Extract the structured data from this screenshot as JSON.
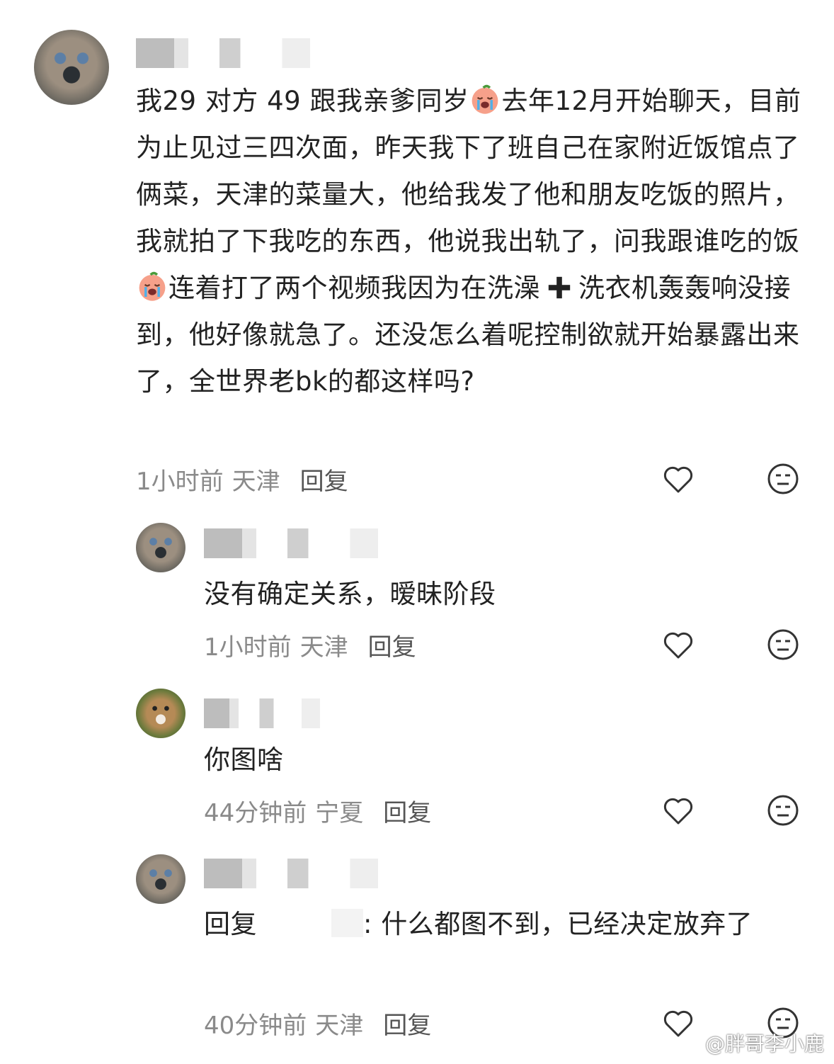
{
  "comments": [
    {
      "text_line1_a": "我29 对方 49 跟我亲爹同岁",
      "text_line1_b": "去年12月开始聊",
      "text_mid": "天，目前为止见过三四次面，昨天我下了班自己在家附近饭馆点了俩菜，天津的菜量大，他给我发了他和朋友吃饭的照片，我就拍了下我吃的东西，他说我出轨了，问我跟谁吃的饭",
      "text_after_emoji2": "连着打了两个视频我因为在洗澡",
      "text_after_plus": "洗衣机轰轰响没接到，他好像就急了。还没怎么着呢控制欲就开始暴露出来了，全世界老bk的都这样吗?",
      "time": "1小时前",
      "region": "天津",
      "reply": "回复"
    },
    {
      "text": "没有确定关系，暧昧阶段",
      "time": "1小时前",
      "region": "天津",
      "reply": "回复"
    },
    {
      "text": "你图啥",
      "time": "44分钟前",
      "region": "宁夏",
      "reply": "回复"
    },
    {
      "text_prefix": "回复",
      "text_body": ": 什么都图不到，已经决定放弃了",
      "time": "40分钟前",
      "region": "天津",
      "reply": "回复"
    }
  ],
  "icons": {
    "like": "heart-outline-icon",
    "dislike": "meh-face-icon",
    "emoji": "crying-peach-emoji",
    "plus": "heavy-plus-emoji"
  },
  "watermark": "@胖哥李小鹿"
}
